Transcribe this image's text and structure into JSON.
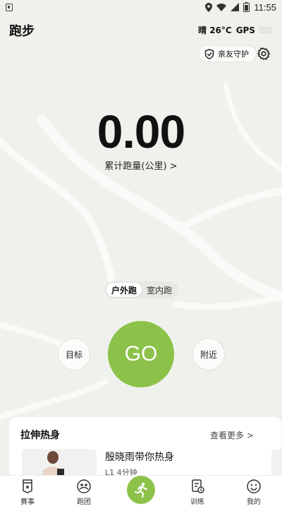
{
  "status": {
    "time": "11:55"
  },
  "header": {
    "title": "跑步",
    "weather": "晴 26°C",
    "gps_label": "GPS"
  },
  "guardian": {
    "label": "亲友守护"
  },
  "stats": {
    "distance": "0.00",
    "distance_label": "累计跑量(公里) >"
  },
  "mode": {
    "outdoor": "户外跑",
    "indoor": "室内跑",
    "selected": "户外跑"
  },
  "actions": {
    "go": "GO",
    "target": "目标",
    "nearby": "附近"
  },
  "warmup": {
    "title": "拉伸热身",
    "more": "查看更多 >",
    "course_title": "殷晓雨带你热身",
    "course_meta": "L1 4分钟"
  },
  "tabs": {
    "events": "赛事",
    "clubs": "跑团",
    "training": "训练",
    "mine": "我的"
  },
  "colors": {
    "accent": "#8dc24a",
    "background": "#eff2ec"
  }
}
